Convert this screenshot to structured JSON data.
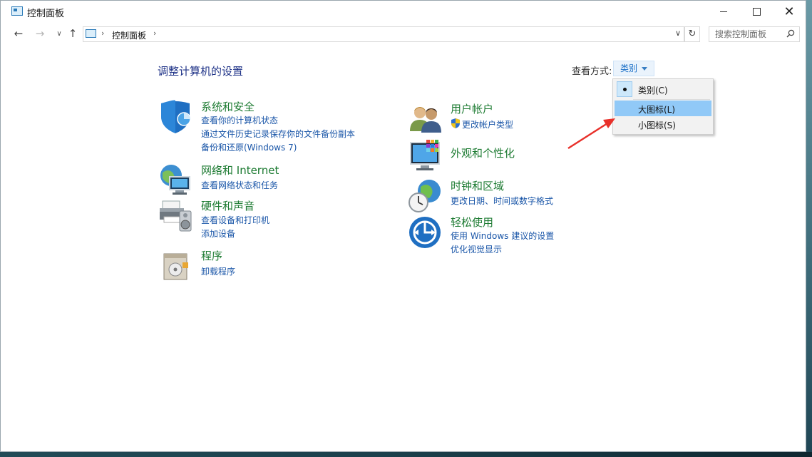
{
  "window": {
    "title": "控制面板"
  },
  "nav": {
    "breadcrumb": "控制面板",
    "search_placeholder": "搜索控制面板"
  },
  "main": {
    "page_title": "调整计算机的设置",
    "view_by_label": "查看方式:",
    "view_by_value": "类别"
  },
  "categories": [
    {
      "title": "系统和安全",
      "links": [
        "查看你的计算机状态",
        "通过文件历史记录保存你的文件备份副本",
        "备份和还原(Windows 7)"
      ]
    },
    {
      "title": "网络和 Internet",
      "links": [
        "查看网络状态和任务"
      ]
    },
    {
      "title": "硬件和声音",
      "links": [
        "查看设备和打印机",
        "添加设备"
      ]
    },
    {
      "title": "程序",
      "links": [
        "卸载程序"
      ]
    },
    {
      "title": "用户帐户",
      "links": [
        "更改帐户类型"
      ]
    },
    {
      "title": "外观和个性化",
      "links": []
    },
    {
      "title": "时钟和区域",
      "links": [
        "更改日期、时间或数字格式"
      ]
    },
    {
      "title": "轻松使用",
      "links": [
        "使用 Windows 建议的设置",
        "优化视觉显示"
      ]
    }
  ],
  "view_menu": {
    "items": [
      {
        "label": "类别(C)",
        "checked": true
      },
      {
        "label": "大图标(L)",
        "highlighted": true
      },
      {
        "label": "小图标(S)"
      }
    ]
  },
  "colors": {
    "category_title": "#1d7b32",
    "link": "#1a56a8",
    "page_title": "#1e3287",
    "menu_highlight": "#91c9f7",
    "annotation_arrow": "#e8302a"
  }
}
